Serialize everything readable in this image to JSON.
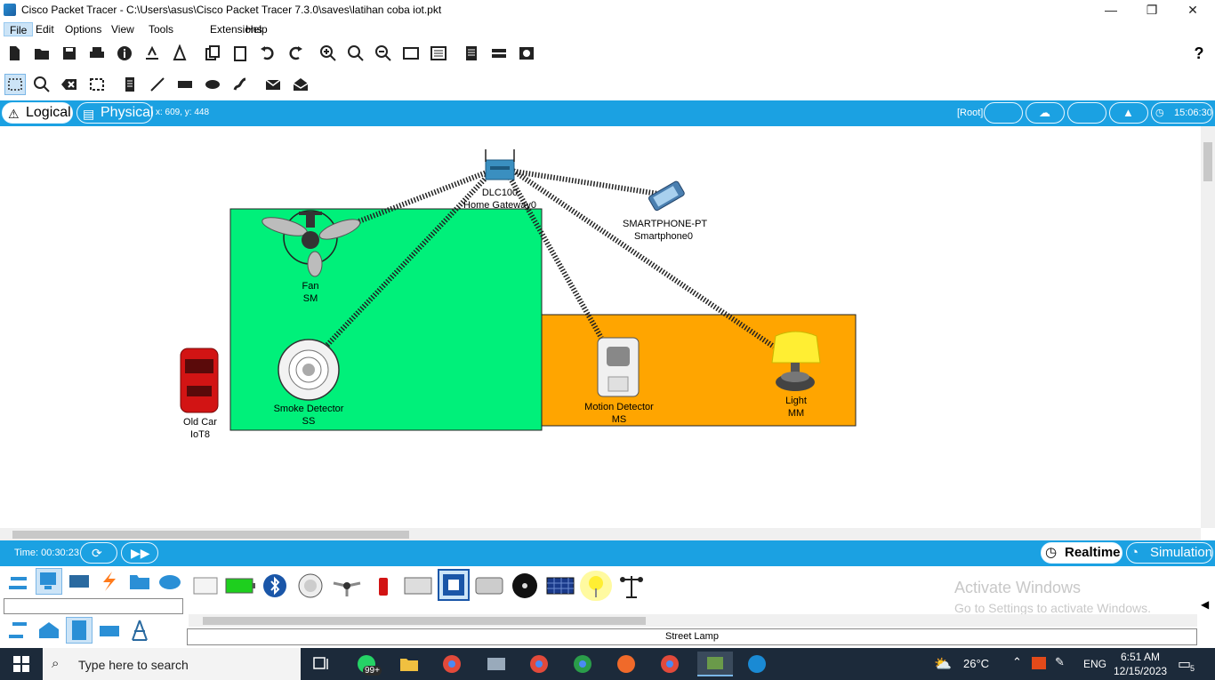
{
  "window": {
    "title": "Cisco Packet Tracer - C:\\Users\\asus\\Cisco Packet Tracer 7.3.0\\saves\\latihan coba iot.pkt",
    "minimize": "—",
    "restore": "❐",
    "close": "✕"
  },
  "menu": [
    "File",
    "Edit",
    "Options",
    "View",
    "Tools",
    "Extensions",
    "Help"
  ],
  "help_glyph": "?",
  "workspace": {
    "logical_label": "Logical",
    "physical_label": "Physical",
    "coords": "x: 609, y: 448",
    "root_label": "[Root]",
    "clock": "15:06:30"
  },
  "devices": {
    "gateway": {
      "line1": "DLC100",
      "line2": "Home Gateway0"
    },
    "smartphone": {
      "line1": "SMARTPHONE-PT",
      "line2": "Smartphone0"
    },
    "fan": {
      "line1": "Fan",
      "line2": "SM"
    },
    "smoke": {
      "line1": "Smoke Detector",
      "line2": "SS"
    },
    "motion": {
      "line1": "Motion Detector",
      "line2": "MS"
    },
    "light": {
      "line1": "Light",
      "line2": "MM"
    },
    "car": {
      "line1": "Old Car",
      "line2": "IoT8"
    }
  },
  "colors": {
    "green_zone": "#00f07a",
    "orange_zone": "#ffa500",
    "accent_blue": "#1ba1e2"
  },
  "simbar": {
    "time": "Time: 00:30:23",
    "realtime": "Realtime",
    "simulation": "Simulation"
  },
  "bottom": {
    "selected_device": "Street Lamp",
    "watermark_title": "Activate Windows",
    "watermark_sub": "Go to Settings to activate Windows."
  },
  "taskbar": {
    "search_placeholder": "Type here to search",
    "badge": "99+",
    "weather": "26°C",
    "lang": "ENG",
    "time": "6:51 AM",
    "date": "12/15/2023",
    "notif_count": "5"
  }
}
